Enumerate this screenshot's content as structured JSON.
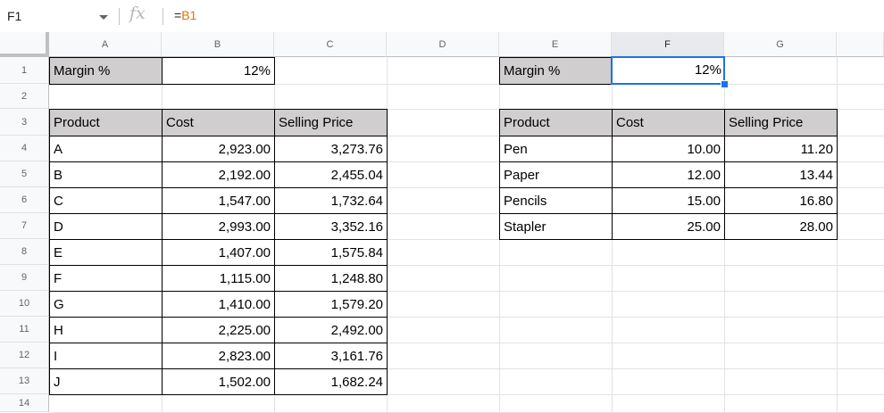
{
  "formula_bar": {
    "name_box": "F1",
    "fx_icon": "function-icon",
    "formula_prefix": "=",
    "formula_ref": "B1"
  },
  "columns": [
    "A",
    "B",
    "C",
    "D",
    "E",
    "F",
    "G"
  ],
  "rows": [
    "1",
    "2",
    "3",
    "4",
    "5",
    "6",
    "7",
    "8",
    "9",
    "10",
    "11",
    "12",
    "13",
    "14"
  ],
  "selected_cell": "F1",
  "left_table": {
    "margin_label": "Margin %",
    "margin_value": "12%",
    "headers": [
      "Product",
      "Cost",
      "Selling Price"
    ],
    "rows": [
      [
        "A",
        "2,923.00",
        "3,273.76"
      ],
      [
        "B",
        "2,192.00",
        "2,455.04"
      ],
      [
        "C",
        "1,547.00",
        "1,732.64"
      ],
      [
        "D",
        "2,993.00",
        "3,352.16"
      ],
      [
        "E",
        "1,407.00",
        "1,575.84"
      ],
      [
        "F",
        "1,115.00",
        "1,248.80"
      ],
      [
        "G",
        "1,410.00",
        "1,579.20"
      ],
      [
        "H",
        "2,225.00",
        "2,492.00"
      ],
      [
        "I",
        "2,823.00",
        "3,161.76"
      ],
      [
        "J",
        "1,502.00",
        "1,682.24"
      ]
    ]
  },
  "right_table": {
    "margin_label": "Margin %",
    "margin_value": "12%",
    "headers": [
      "Product",
      "Cost",
      "Selling Price"
    ],
    "rows": [
      [
        "Pen",
        "10.00",
        "11.20"
      ],
      [
        "Paper",
        "12.00",
        "13.44"
      ],
      [
        "Pencils",
        "15.00",
        "16.80"
      ],
      [
        "Stapler",
        "25.00",
        "28.00"
      ]
    ]
  },
  "colors": {
    "header_fill": "#d0cece",
    "selection": "#1a73e8",
    "formula_ref": "#e37400"
  }
}
